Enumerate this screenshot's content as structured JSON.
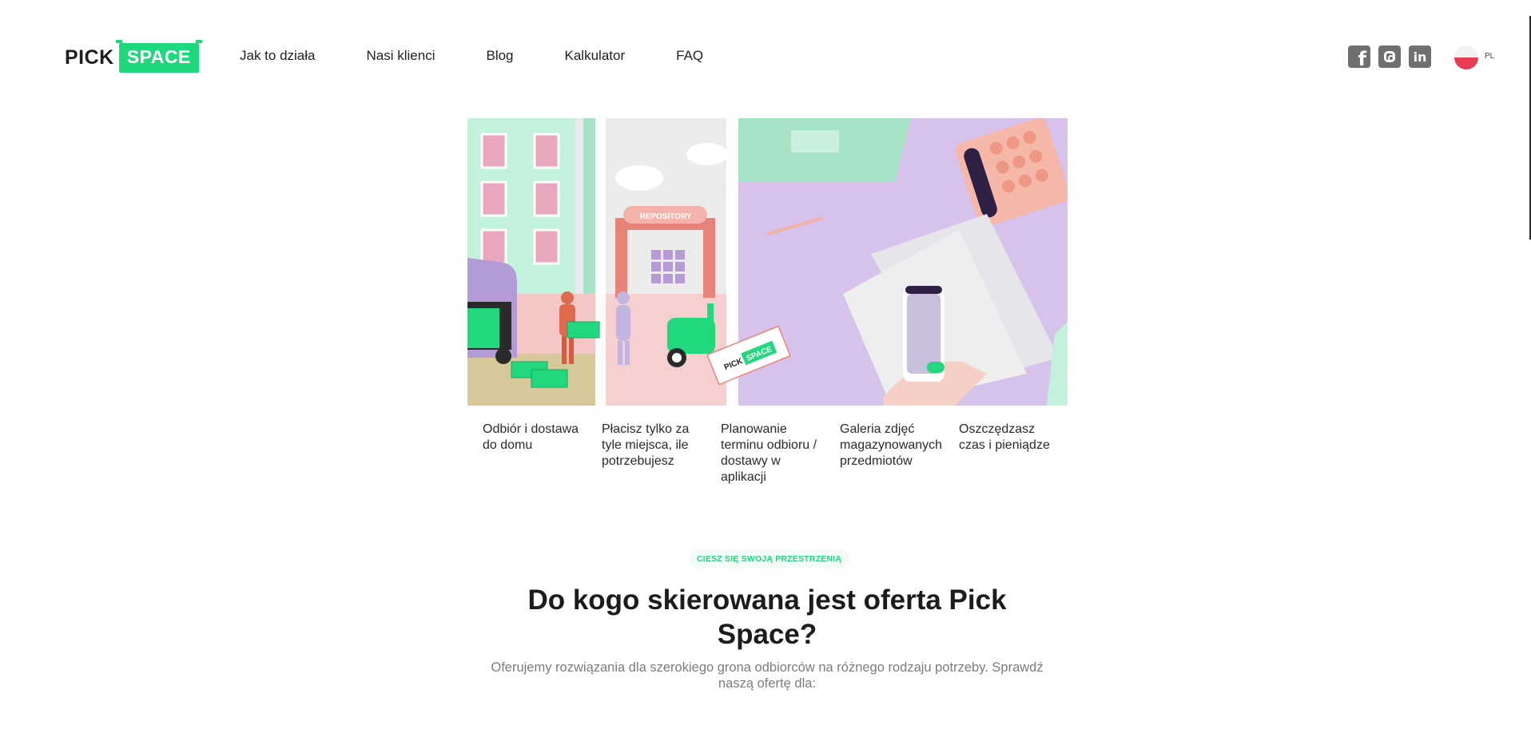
{
  "logo": {
    "pick": "PICK",
    "space": "SPACE"
  },
  "nav": [
    {
      "label": "Jak to działa"
    },
    {
      "label": "Nasi klienci"
    },
    {
      "label": "Blog"
    },
    {
      "label": "Kalkulator"
    },
    {
      "label": "FAQ"
    }
  ],
  "socials": [
    {
      "icon": "facebook-icon"
    },
    {
      "icon": "instagram-icon"
    },
    {
      "icon": "linkedin-icon"
    }
  ],
  "language": {
    "code": "PL",
    "flag": "poland-flag-icon"
  },
  "illustration": {
    "repository_sign": "REPOSITORY",
    "card_pick": "PICK",
    "card_space": "SPACE"
  },
  "features": [
    "Odbiór i dostawa do domu",
    "Płacisz tylko za tyle miejsca, ile potrzebujesz",
    "Planowanie terminu odbioru / dostawy w aplikacji",
    "Galeria zdjęć magazynowanych przedmiotów",
    "Oszczędzasz czas i pieniądze"
  ],
  "section": {
    "badge": "CIESZ SIĘ SWOJĄ PRZESTRZENIĄ",
    "heading": "Do kogo skierowana jest oferta Pick Space?",
    "subtext": "Oferujemy rozwiązania dla szerokiego grona odbiorców na różnego rodzaju potrzeby. Sprawdź naszą ofertę dla:"
  },
  "colors": {
    "brand": "#1ed87d",
    "text": "#1e1c1b",
    "muted": "#7c7c7c",
    "icon_grey": "#6f6f6f"
  }
}
